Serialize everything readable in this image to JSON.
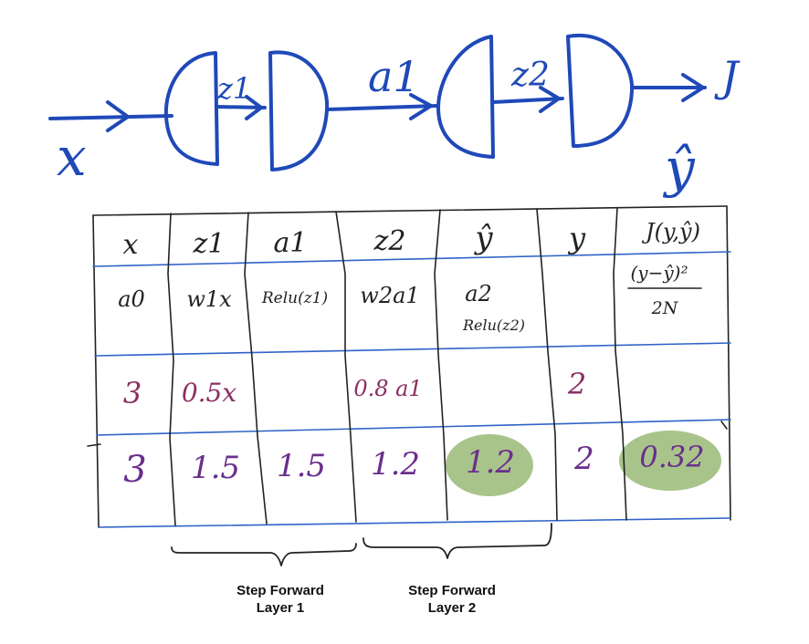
{
  "colors": {
    "diagram_ink": "#1f49b8",
    "table_border": "#222222",
    "row_line": "#2f63c9",
    "value_ink": "#8a2f63",
    "highlight": "#a9c48b",
    "text_ink": "#222222"
  },
  "diagram": {
    "input_label": "x",
    "z1_label": "z1",
    "a1_label": "a1",
    "z2_label": "z2",
    "output_label": "J",
    "yhat_label": "ŷ"
  },
  "table": {
    "headers": [
      "x",
      "z1",
      "a1",
      "z2",
      "ŷ",
      "y",
      "J(y,ŷ)"
    ],
    "formulas": {
      "x": "a0",
      "z1": "w1x",
      "a1": "Relu(z1)",
      "z2": "w2a1",
      "yhat_main": "a2",
      "yhat_sub": "Relu(z2)",
      "J_numerator": "(y−ŷ)²",
      "J_denominator": "2N"
    },
    "params_row": [
      "3",
      "0.5x",
      "",
      "0.8 a1",
      "",
      "2",
      ""
    ],
    "values_row": [
      "3",
      "1.5",
      "1.5",
      "1.2",
      "1.2",
      "2",
      "0.32"
    ],
    "highlighted_columns": [
      "ŷ",
      "J(y,ŷ)"
    ]
  },
  "captions": {
    "layer1_line1": "Step Forward",
    "layer1_line2": "Layer 1",
    "layer2_line1": "Step Forward",
    "layer2_line2": "Layer 2"
  }
}
